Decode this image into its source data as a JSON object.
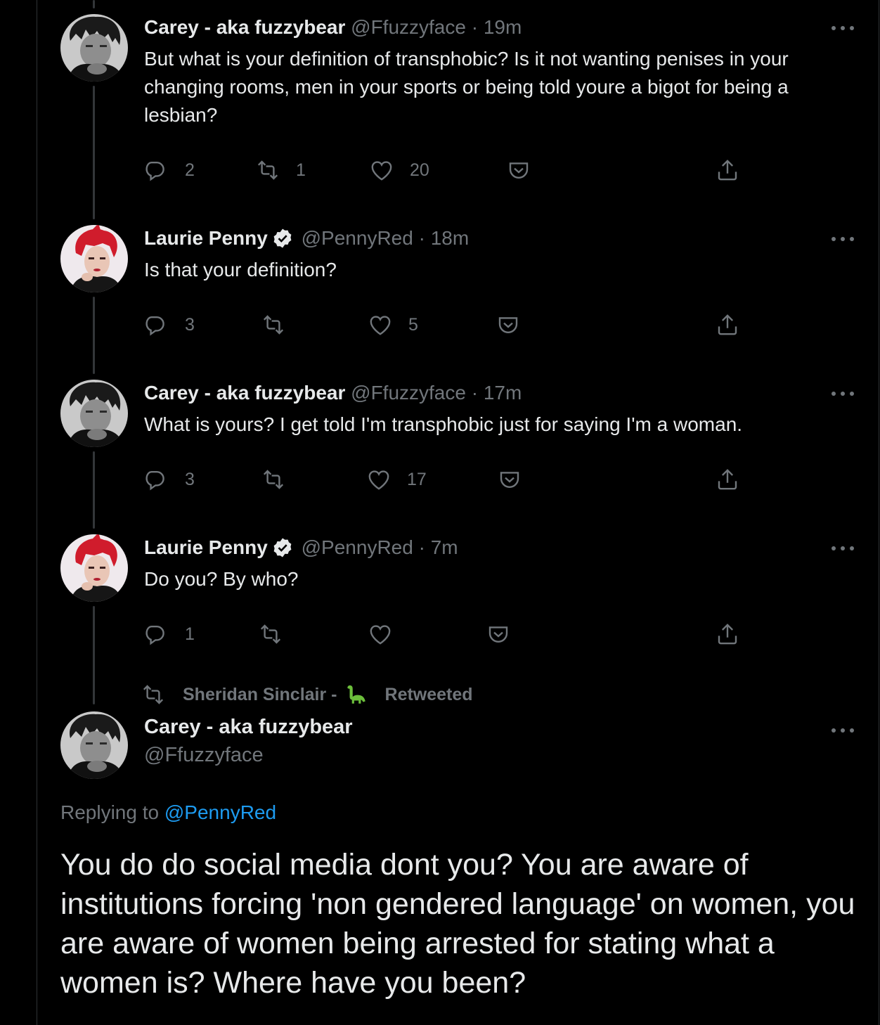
{
  "tweets": [
    {
      "name": "Carey - aka fuzzybear",
      "handle": "@Ffuzzyface",
      "separator": "·",
      "time": "19m",
      "verified": false,
      "text": "But what is your definition of transphobic? Is it not wanting penises in your changing rooms, men in your sports or being told youre a bigot for being a lesbian?",
      "replies": "2",
      "retweets": "1",
      "likes": "20"
    },
    {
      "name": "Laurie Penny",
      "handle": "@PennyRed",
      "separator": "·",
      "time": "18m",
      "verified": true,
      "text": "Is that your definition?",
      "replies": "3",
      "retweets": "",
      "likes": "5"
    },
    {
      "name": "Carey - aka fuzzybear",
      "handle": "@Ffuzzyface",
      "separator": "·",
      "time": "17m",
      "verified": false,
      "text": "What is yours? I get told I'm transphobic just for saying I'm a woman.",
      "replies": "3",
      "retweets": "",
      "likes": "17"
    },
    {
      "name": "Laurie Penny",
      "handle": "@PennyRed",
      "separator": "·",
      "time": "7m",
      "verified": true,
      "text": "Do you? By who?",
      "replies": "1",
      "retweets": "",
      "likes": ""
    }
  ],
  "retweet_banner": {
    "user": "Sheridan Sinclair -",
    "emoji_icon": "sauropod-icon",
    "label": "Retweeted"
  },
  "focus_tweet": {
    "name": "Carey - aka fuzzybear",
    "handle": "@Ffuzzyface",
    "replying_prefix": "Replying to",
    "replying_to": "@PennyRed",
    "text": "You do do social media dont you? You are aware of institutions forcing 'non gendered language' on women, you are aware of women being arrested for stating what a women is? Where have you been?"
  },
  "icons": {
    "reply": "reply-icon",
    "retweet": "retweet-icon",
    "like": "heart-icon",
    "save": "pocket-icon",
    "share": "share-icon",
    "more": "more-icon",
    "verified": "verified-badge-icon"
  },
  "colors": {
    "background": "#000000",
    "text": "#e7e9ea",
    "secondary": "#71767b",
    "link": "#1d9bf0",
    "thread_line": "#333639"
  }
}
